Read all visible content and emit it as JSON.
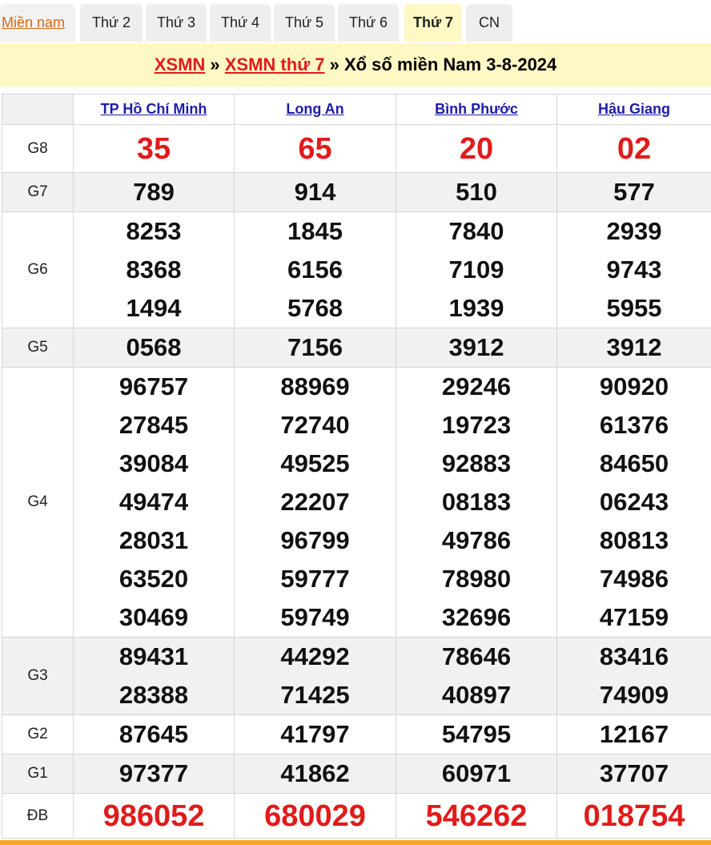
{
  "tabs": [
    {
      "label": "Miền nam"
    },
    {
      "label": "Thứ 2"
    },
    {
      "label": "Thứ 3"
    },
    {
      "label": "Thứ 4"
    },
    {
      "label": "Thứ 5"
    },
    {
      "label": "Thứ 6"
    },
    {
      "label": "Thứ 7"
    },
    {
      "label": "CN"
    }
  ],
  "active_tab": "Thứ 7",
  "header": {
    "link1": "XSMN",
    "sep1": " » ",
    "link2": "XSMN thứ 7",
    "sep2": " » ",
    "title": "Xổ số miền Nam 3-8-2024"
  },
  "provinces": [
    "TP Hồ Chí Minh",
    "Long An",
    "Bình Phước",
    "Hậu Giang"
  ],
  "prizes": [
    {
      "label": "G8",
      "values": [
        [
          "35"
        ],
        [
          "65"
        ],
        [
          "20"
        ],
        [
          "02"
        ]
      ]
    },
    {
      "label": "G7",
      "values": [
        [
          "789"
        ],
        [
          "914"
        ],
        [
          "510"
        ],
        [
          "577"
        ]
      ]
    },
    {
      "label": "G6",
      "values": [
        [
          "8253",
          "8368",
          "1494"
        ],
        [
          "1845",
          "6156",
          "5768"
        ],
        [
          "7840",
          "7109",
          "1939"
        ],
        [
          "2939",
          "9743",
          "5955"
        ]
      ]
    },
    {
      "label": "G5",
      "values": [
        [
          "0568"
        ],
        [
          "7156"
        ],
        [
          "3912"
        ],
        [
          "3912"
        ]
      ]
    },
    {
      "label": "G4",
      "values": [
        [
          "96757",
          "27845",
          "39084",
          "49474",
          "28031",
          "63520",
          "30469"
        ],
        [
          "88969",
          "72740",
          "49525",
          "22207",
          "96799",
          "59777",
          "59749"
        ],
        [
          "29246",
          "19723",
          "92883",
          "08183",
          "49786",
          "78980",
          "32696"
        ],
        [
          "90920",
          "61376",
          "84650",
          "06243",
          "80813",
          "74986",
          "47159"
        ]
      ]
    },
    {
      "label": "G3",
      "values": [
        [
          "89431",
          "28388"
        ],
        [
          "44292",
          "71425"
        ],
        [
          "78646",
          "40897"
        ],
        [
          "83416",
          "74909"
        ]
      ]
    },
    {
      "label": "G2",
      "values": [
        [
          "87645"
        ],
        [
          "41797"
        ],
        [
          "54795"
        ],
        [
          "12167"
        ]
      ]
    },
    {
      "label": "G1",
      "values": [
        [
          "97377"
        ],
        [
          "41862"
        ],
        [
          "60971"
        ],
        [
          "37707"
        ]
      ]
    },
    {
      "label": "ĐB",
      "values": [
        [
          "986052"
        ],
        [
          "680029"
        ],
        [
          "546262"
        ],
        [
          "018754"
        ]
      ]
    }
  ],
  "colors": {
    "accent_red": "#e11b1b",
    "link_blue": "#1d1da8",
    "header_bg": "#fff8c4",
    "tab_first_text": "#d4690f",
    "bottom_bar": "#f5a623"
  }
}
